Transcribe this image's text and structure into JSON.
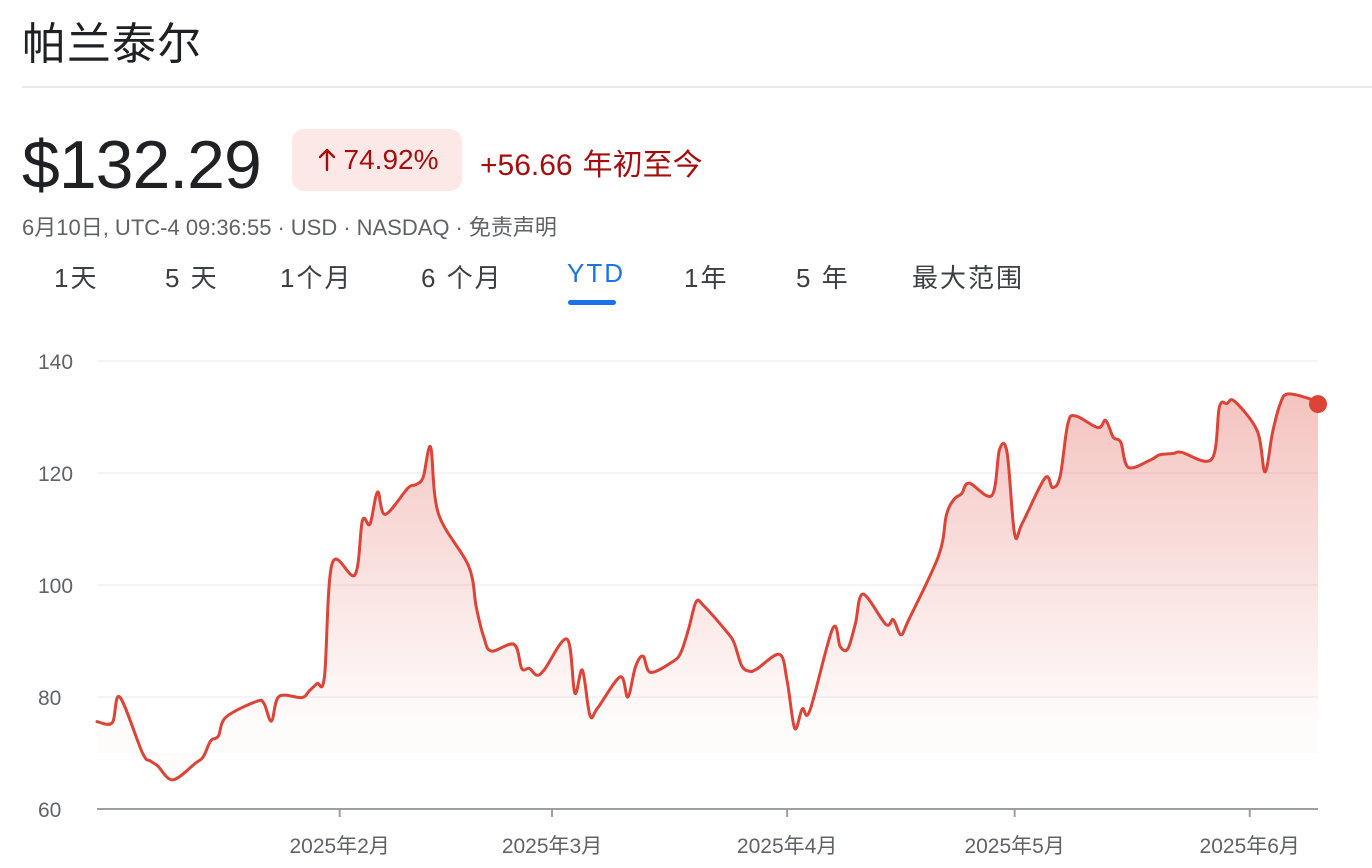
{
  "header": {
    "title": "帕兰泰尔"
  },
  "quote": {
    "price": "$132.29",
    "percent_change": "74.92%",
    "absolute_change": "+56.66",
    "period_label": "年初至今",
    "date_time": "6月10日, UTC-4 09:36:55",
    "currency": "USD",
    "exchange": "NASDAQ",
    "disclaimer": "免责声明",
    "separator": "·",
    "colors": {
      "negative_text": "#a50e0e",
      "badge_bg": "#fce8e6",
      "line": "#db4437",
      "active_tab": "#1a73e8"
    }
  },
  "tabs": [
    {
      "label": "1天",
      "active": false
    },
    {
      "label": "5 天",
      "active": false
    },
    {
      "label": "1个月",
      "active": false
    },
    {
      "label": "6 个月",
      "active": false
    },
    {
      "label": "YTD",
      "active": true
    },
    {
      "label": "1年",
      "active": false
    },
    {
      "label": "5 年",
      "active": false
    },
    {
      "label": "最大范围",
      "active": false
    }
  ],
  "icons": {
    "change_arrow": "arrow-up-icon"
  },
  "chart_data": {
    "type": "area",
    "title": "",
    "xlabel": "",
    "ylabel": "",
    "ylim": [
      60,
      140
    ],
    "y_ticks": [
      60,
      80,
      100,
      120,
      140
    ],
    "x_tick_labels": [
      "2025年2月",
      "2025年3月",
      "2025年4月",
      "2025年5月",
      "2025年6月"
    ],
    "x_ticks": [
      "2025-02-01",
      "2025-03-01",
      "2025-04-01",
      "2025-05-01",
      "2025-06-01"
    ],
    "x_range": [
      "2024-12-31",
      "2025-06-10"
    ],
    "grid": true,
    "legend": "none",
    "end_marker": true,
    "series": [
      {
        "x": [
          "2024-12-31",
          "2025-01-02",
          "2025-01-03",
          "2025-01-06",
          "2025-01-07",
          "2025-01-08",
          "2025-01-10",
          "2025-01-13",
          "2025-01-14",
          "2025-01-15",
          "2025-01-16",
          "2025-01-17",
          "2025-01-21",
          "2025-01-22",
          "2025-01-23",
          "2025-01-24",
          "2025-01-27",
          "2025-01-28",
          "2025-01-29",
          "2025-01-30",
          "2025-01-31",
          "2025-02-03",
          "2025-02-04",
          "2025-02-05",
          "2025-02-06",
          "2025-02-07",
          "2025-02-10",
          "2025-02-11",
          "2025-02-12",
          "2025-02-13",
          "2025-02-14",
          "2025-02-18",
          "2025-02-19",
          "2025-02-20",
          "2025-02-21",
          "2025-02-24",
          "2025-02-25",
          "2025-02-26",
          "2025-02-27",
          "2025-02-28",
          "2025-03-03",
          "2025-03-04",
          "2025-03-05",
          "2025-03-06",
          "2025-03-07",
          "2025-03-10",
          "2025-03-11",
          "2025-03-12",
          "2025-03-13",
          "2025-03-14",
          "2025-03-17",
          "2025-03-18",
          "2025-03-19",
          "2025-03-20",
          "2025-03-21",
          "2025-03-24",
          "2025-03-25",
          "2025-03-26",
          "2025-03-27",
          "2025-03-28",
          "2025-03-31",
          "2025-04-01",
          "2025-04-02",
          "2025-04-03",
          "2025-04-04",
          "2025-04-07",
          "2025-04-08",
          "2025-04-09",
          "2025-04-10",
          "2025-04-11",
          "2025-04-14",
          "2025-04-15",
          "2025-04-16",
          "2025-04-17",
          "2025-04-21",
          "2025-04-22",
          "2025-04-23",
          "2025-04-24",
          "2025-04-25",
          "2025-04-28",
          "2025-04-29",
          "2025-04-30",
          "2025-05-01",
          "2025-05-02",
          "2025-05-05",
          "2025-05-06",
          "2025-05-07",
          "2025-05-08",
          "2025-05-09",
          "2025-05-12",
          "2025-05-13",
          "2025-05-14",
          "2025-05-15",
          "2025-05-16",
          "2025-05-19",
          "2025-05-20",
          "2025-05-21",
          "2025-05-22",
          "2025-05-23",
          "2025-05-27",
          "2025-05-28",
          "2025-05-29",
          "2025-05-30",
          "2025-06-02",
          "2025-06-03",
          "2025-06-04",
          "2025-06-05",
          "2025-06-06",
          "2025-06-09",
          "2025-06-10"
        ],
        "values": [
          75.6,
          75.4,
          80.0,
          70.0,
          68.6,
          67.7,
          65.2,
          68.2,
          69.3,
          72.2,
          73.0,
          76.4,
          79.2,
          78.9,
          75.7,
          80.1,
          79.9,
          81.1,
          82.4,
          83.7,
          103.8,
          101.8,
          111.5,
          110.9,
          116.6,
          112.6,
          117.3,
          117.9,
          119.2,
          124.6,
          112.8,
          103.4,
          96.1,
          90.7,
          88.2,
          89.4,
          85.1,
          85.1,
          83.9,
          84.9,
          90.3,
          80.7,
          84.8,
          76.7,
          78.0,
          83.6,
          80.0,
          85.4,
          87.3,
          84.4,
          86.4,
          88.0,
          92.1,
          97.0,
          96.3,
          91.7,
          89.7,
          85.6,
          84.6,
          85.0,
          87.6,
          82.9,
          74.4,
          77.9,
          77.6,
          92.2,
          89.0,
          88.6,
          93.1,
          98.4,
          93.0,
          93.8,
          91.1,
          93.7,
          105.3,
          112.5,
          115.3,
          116.3,
          118.2,
          116.0,
          124.2,
          123.6,
          109.1,
          111.0,
          119.1,
          117.4,
          119.4,
          128.7,
          130.2,
          128.1,
          129.4,
          126.4,
          125.5,
          121.0,
          122.4,
          123.2,
          123.4,
          123.5,
          123.7,
          122.5,
          131.8,
          132.4,
          132.8,
          127.5,
          120.2,
          127.2,
          132.3,
          134.1,
          133.2,
          132.3
        ]
      }
    ]
  }
}
